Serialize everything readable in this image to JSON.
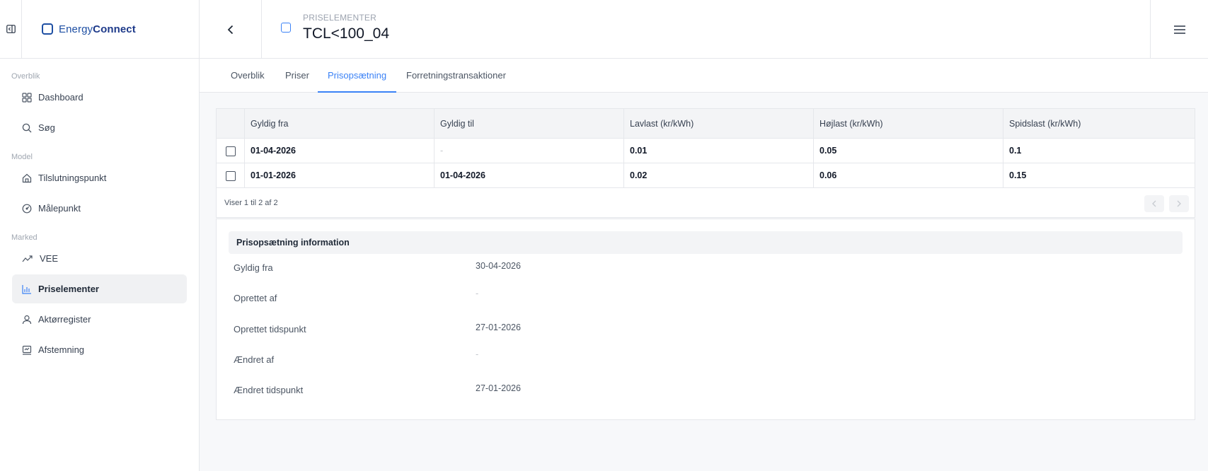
{
  "app": {
    "brand_light": "Energy",
    "brand_bold": "Connect"
  },
  "sidebar": {
    "sections": [
      {
        "label": "Overblik"
      },
      {
        "label": "Model"
      },
      {
        "label": "Marked"
      }
    ],
    "items": [
      {
        "label": "Dashboard",
        "icon": "grid-icon"
      },
      {
        "label": "Søg",
        "icon": "search-icon"
      },
      {
        "label": "Tilslutningspunkt",
        "icon": "house-icon"
      },
      {
        "label": "Målepunkt",
        "icon": "gauge-icon"
      },
      {
        "label": "VEE",
        "icon": "trend-icon"
      },
      {
        "label": "Priselementer",
        "icon": "price-chart-icon",
        "active": true
      },
      {
        "label": "Aktørregister",
        "icon": "user-icon"
      },
      {
        "label": "Afstemning",
        "icon": "reconcile-icon"
      }
    ]
  },
  "header": {
    "eyebrow": "PRISELEMENTER",
    "title": "TCL<100_04"
  },
  "tabs": [
    {
      "label": "Overblik"
    },
    {
      "label": "Priser"
    },
    {
      "label": "Prisopsætning",
      "active": true
    },
    {
      "label": "Forretningstransaktioner"
    }
  ],
  "table": {
    "columns": [
      "Gyldig fra",
      "Gyldig til",
      "Lavlast (kr/kWh)",
      "Højlast (kr/kWh)",
      "Spidslast (kr/kWh)"
    ],
    "rows": [
      {
        "gyldig_fra": "01-04-2026",
        "gyldig_til": "-",
        "lavlast": "0.01",
        "hojlast": "0.05",
        "spidslast": "0.1"
      },
      {
        "gyldig_fra": "01-01-2026",
        "gyldig_til": "01-04-2026",
        "lavlast": "0.02",
        "hojlast": "0.06",
        "spidslast": "0.15"
      }
    ],
    "pagination_text": "Viser 1 til 2 af 2"
  },
  "info": {
    "heading": "Prisopsætning information",
    "fields": [
      {
        "label": "Gyldig fra",
        "value": "30-04-2026"
      },
      {
        "label": "Oprettet af",
        "value": "-"
      },
      {
        "label": "Oprettet tidspunkt",
        "value": "27-01-2026"
      },
      {
        "label": "Ændret af",
        "value": "-"
      },
      {
        "label": "Ændret tidspunkt",
        "value": "27-01-2026"
      }
    ]
  },
  "colors": {
    "accent": "#3b82f6",
    "brand": "#1e4fa3",
    "active_nav_bg": "#f0f1f3"
  }
}
